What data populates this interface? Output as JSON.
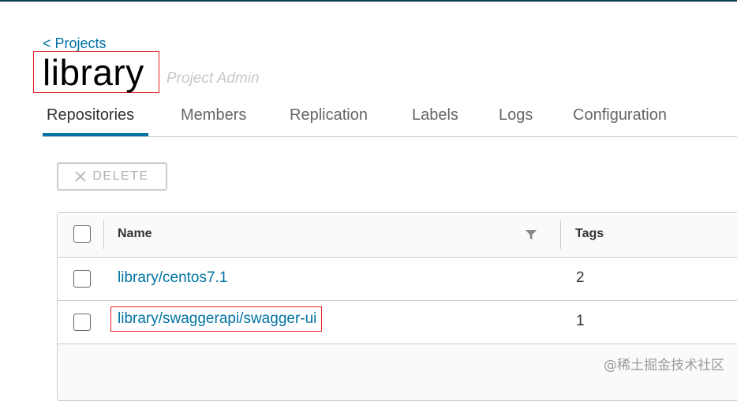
{
  "breadcrumb": {
    "label": "< Projects"
  },
  "project": {
    "title": "library",
    "role": "Project Admin"
  },
  "tabs": [
    {
      "label": "Repositories",
      "active": true
    },
    {
      "label": "Members"
    },
    {
      "label": "Replication"
    },
    {
      "label": "Labels"
    },
    {
      "label": "Logs"
    },
    {
      "label": "Configuration"
    }
  ],
  "toolbar": {
    "delete_label": "DELETE",
    "delete_icon": "close-icon"
  },
  "table": {
    "columns": [
      {
        "label": "Name",
        "filter_icon": "filter-icon"
      },
      {
        "label": "Tags"
      }
    ],
    "rows": [
      {
        "name": "library/centos7.1",
        "tags": "2"
      },
      {
        "name": "library/swaggerapi/swagger-ui",
        "tags": "1"
      }
    ]
  },
  "watermark": "@稀土掘金技术社区",
  "colors": {
    "link": "#0072a3",
    "highlight_box": "#e02020",
    "active_tab_underline": "#0072a3",
    "top_rule": "#0f3b4f"
  }
}
